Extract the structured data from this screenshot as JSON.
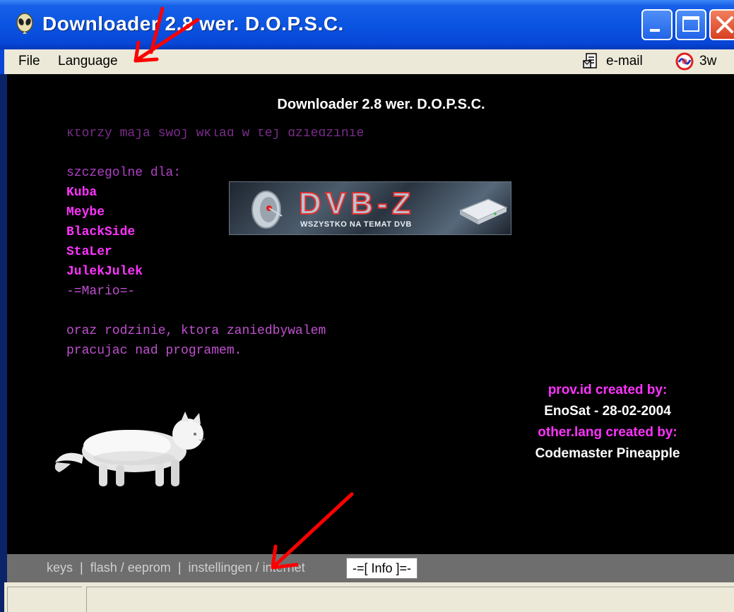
{
  "window": {
    "title": "Downloader 2.8 wer. D.O.P.S.C."
  },
  "menu": {
    "file": "File",
    "language": "Language",
    "email": "e-mail",
    "web": "3w"
  },
  "content": {
    "heading": "Downloader 2.8 wer. D.O.P.S.C.",
    "scroll_line": "ktorzy maja swoj wklad w tej dziedzinie",
    "intro": "szczegolne dla:",
    "names": [
      "Kuba",
      "Meybe",
      "BlackSide",
      "StaLer",
      "JulekJulek"
    ],
    "mario": "-=Mario=-",
    "closing_line1": "oraz rodzinie, ktora zaniedbywalem",
    "closing_line2": "pracujac nad programem.",
    "banner_title": "DVB-Z",
    "banner_subtitle": "WSZYSTKO NA TEMAT DVB",
    "side_credits": {
      "provid_label": "prov.id created by:",
      "provid_author": "EnoSat - 28-02-2004",
      "lang_label": "other.lang created by:",
      "lang_author": "Codemaster Pineapple"
    }
  },
  "tabs": {
    "keys": "keys",
    "flash": "flash / eeprom",
    "settings": "instellingen / internet",
    "separator": "|",
    "info": "-=[ Info ]=-"
  },
  "colors": {
    "titlebar": "#0a54e2",
    "content_bg": "#000000",
    "magenta": "#ff33ff",
    "annotation_red": "#ff0000"
  }
}
